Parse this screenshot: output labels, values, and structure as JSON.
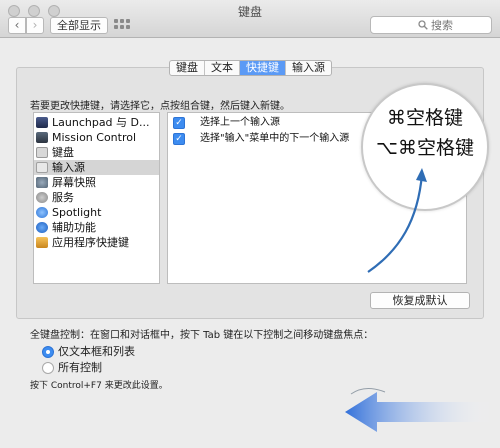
{
  "window": {
    "title": "键盘"
  },
  "toolbar": {
    "back_glyph": "‹",
    "forward_glyph": "›",
    "show_all_label": "全部显示",
    "search_placeholder": "搜索"
  },
  "tabs": [
    {
      "label": "键盘",
      "active": false
    },
    {
      "label": "文本",
      "active": false
    },
    {
      "label": "快捷键",
      "active": true
    },
    {
      "label": "输入源",
      "active": false
    }
  ],
  "instruction": "若要更改快捷键，请选择它，点按组合键，然后键入新键。",
  "categories": [
    {
      "label": "Launchpad 与 D...",
      "icon": "launchpad-icon",
      "selected": false
    },
    {
      "label": "Mission Control",
      "icon": "mission-control-icon",
      "selected": false
    },
    {
      "label": "键盘",
      "icon": "keyboard-icon",
      "selected": false
    },
    {
      "label": "输入源",
      "icon": "input-source-icon",
      "selected": true
    },
    {
      "label": "屏幕快照",
      "icon": "screenshot-icon",
      "selected": false
    },
    {
      "label": "服务",
      "icon": "services-gear-icon",
      "selected": false
    },
    {
      "label": "Spotlight",
      "icon": "spotlight-icon",
      "selected": false
    },
    {
      "label": "辅助功能",
      "icon": "accessibility-icon",
      "selected": false
    },
    {
      "label": "应用程序快捷键",
      "icon": "app-shortcuts-icon",
      "selected": false
    }
  ],
  "shortcuts": [
    {
      "label": "选择上一个输入源",
      "checked": true,
      "check_glyph": "✓"
    },
    {
      "label": "选择\"输入\"菜单中的下一个输入源",
      "checked": true,
      "check_glyph": "✓"
    }
  ],
  "magnified_keys": [
    "⌘空格键",
    "⌥⌘空格键"
  ],
  "restore_defaults_label": "恢复成默认",
  "keyboard_control": {
    "label": "全键盘控制：在窗口和对话框中，按下 Tab 键在以下控制之间移动键盘焦点：",
    "options": [
      {
        "label": "仅文本框和列表",
        "selected": true
      },
      {
        "label": "所有控制",
        "selected": false
      }
    ],
    "footnote": "按下 Control+F7 来更改此设置。"
  },
  "colors": {
    "accent": "#3d8cf0",
    "arrow": "#2f6db5",
    "selected_row": "#d5d5d5"
  }
}
